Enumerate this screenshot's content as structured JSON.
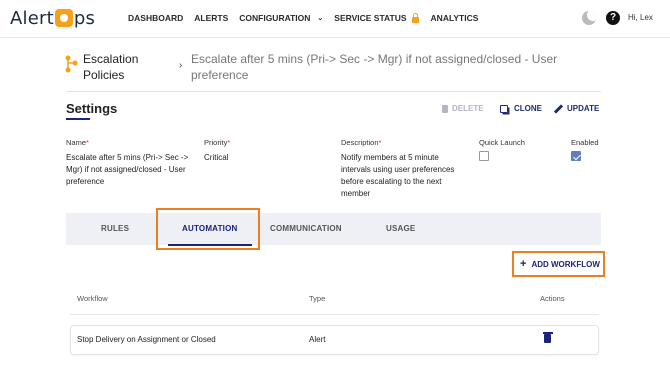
{
  "nav": {
    "logo_pre": "Alert",
    "logo_post": "ps",
    "items": [
      "DASHBOARD",
      "ALERTS",
      "CONFIGURATION",
      "SERVICE STATUS",
      "ANALYTICS"
    ],
    "user_greeting": "Hi, Lex"
  },
  "breadcrumb": {
    "section": "Escalation Policies",
    "page": "Escalate after 5 mins (Pri-> Sec -> Mgr) if not assigned/closed - User preference"
  },
  "settings": {
    "title": "Settings",
    "delete_label": "DELETE",
    "clone_label": "CLONE",
    "update_label": "UPDATE",
    "fields": {
      "name_label": "Name",
      "name_value": "Escalate after 5 mins (Pri-> Sec -> Mgr) if not assigned/closed - User preference",
      "priority_label": "Priority",
      "priority_value": "Critical",
      "description_label": "Description",
      "description_value": "Notify members at 5 minute intervals using user preferences before escalating to the next member",
      "quick_launch_label": "Quick Launch",
      "quick_launch_checked": false,
      "enabled_label": "Enabled",
      "enabled_checked": true
    }
  },
  "tabs": [
    {
      "label": "RULES",
      "active": false
    },
    {
      "label": "AUTOMATION",
      "active": true
    },
    {
      "label": "COMMUNICATION",
      "active": false
    },
    {
      "label": "USAGE",
      "active": false
    }
  ],
  "add_workflow_label": "ADD WORKFLOW",
  "table": {
    "headers": {
      "workflow": "Workflow",
      "type": "Type",
      "actions": "Actions"
    },
    "rows": [
      {
        "workflow": "Stop Delivery on Assignment or Closed",
        "type": "Alert"
      }
    ]
  },
  "colors": {
    "accent": "#1a237e",
    "highlight": "#ef7d22",
    "brand": "#f7a01c"
  }
}
